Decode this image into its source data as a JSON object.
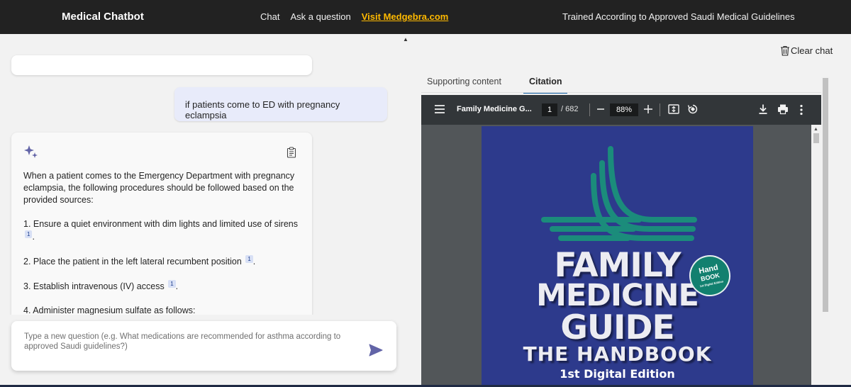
{
  "header": {
    "brand": "Medical Chatbot",
    "nav": [
      {
        "label": "Chat"
      },
      {
        "label": "Ask a question"
      }
    ],
    "external_link": "Visit Medgebra.com",
    "tagline": "Trained According to Approved Saudi Medical Guidelines"
  },
  "toolbar": {
    "clear_chat": "Clear chat"
  },
  "chat": {
    "user_question": "if patients come to ED with pregnancy eclampsia",
    "answer": {
      "intro": "When a patient comes to the Emergency Department with pregnancy eclampsia, the following procedures should be followed based on the provided sources:",
      "steps": [
        {
          "text": "1. Ensure a quiet environment with dim lights and limited use of sirens",
          "citation": "1",
          "tail": "."
        },
        {
          "text": "2. Place the patient in the left lateral recumbent position",
          "citation": "1",
          "tail": "."
        },
        {
          "text": "3. Establish intravenous (IV) access",
          "citation": "1",
          "tail": "."
        },
        {
          "text": "4. Administer magnesium sulfate as follows:"
        }
      ]
    }
  },
  "input": {
    "placeholder": "Type a new question (e.g. What medications are recommended for asthma according to approved Saudi guidelines?)"
  },
  "panel": {
    "tabs": [
      {
        "label": "Supporting content",
        "active": false
      },
      {
        "label": "Citation",
        "active": true
      }
    ]
  },
  "pdf_viewer": {
    "doc_title": "Family Medicine G...",
    "page_current": "1",
    "page_total": "/ 682",
    "zoom": "88%"
  },
  "pdf_cover": {
    "line1": "FAMILY",
    "line2": "MEDICINE",
    "line3": "GUIDE",
    "line4": "THE HANDBOOK",
    "edition": "1st Digital Edition",
    "badge_line1": "Hand",
    "badge_line2": "BOOK",
    "badge_line3": "1st Digital Edition"
  },
  "colors": {
    "topbar": "#222222",
    "accent_link": "#ffb900",
    "user_bubble": "#e8ebfa",
    "send_icon": "#6264a7",
    "cover_blue": "#2d3a8c",
    "cover_teal": "#12806f"
  }
}
